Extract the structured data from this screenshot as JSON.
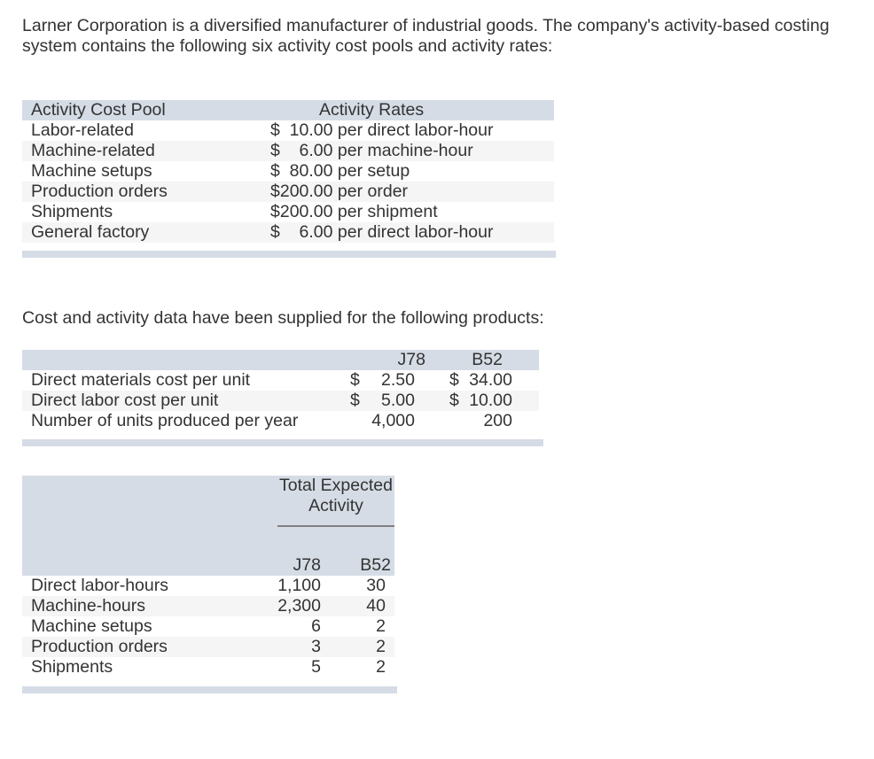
{
  "intro": "Larner Corporation is a diversified manufacturer of industrial goods. The company's activity-based costing system contains the following six activity cost pools and activity rates:",
  "table1": {
    "headers": [
      "Activity Cost Pool",
      "Activity Rates"
    ],
    "rows": [
      {
        "pool": "Labor-related",
        "rate": "$  10.00 per direct labor-hour"
      },
      {
        "pool": "Machine-related",
        "rate": "$    6.00 per machine-hour"
      },
      {
        "pool": "Machine setups",
        "rate": "$  80.00 per setup"
      },
      {
        "pool": "Production orders",
        "rate": "$200.00 per order"
      },
      {
        "pool": "Shipments",
        "rate": "$200.00 per shipment"
      },
      {
        "pool": "General factory",
        "rate": "$    6.00 per direct labor-hour"
      }
    ]
  },
  "section2_text": "Cost and activity data have been supplied for the following products:",
  "table2": {
    "headers": [
      "",
      "J78",
      "B52"
    ],
    "rows": [
      {
        "label": "Direct materials cost per unit",
        "j_cur": "$",
        "j78": "2.50",
        "b_cur": "$",
        "b52": "34.00"
      },
      {
        "label": "Direct labor cost per unit",
        "j_cur": "$",
        "j78": "5.00",
        "b_cur": "$",
        "b52": "10.00"
      },
      {
        "label": "Number of units produced per year",
        "j_cur": "",
        "j78": "4,000",
        "b_cur": "",
        "b52": "200"
      }
    ]
  },
  "table3": {
    "group_header_line1": "Total Expected",
    "group_header_line2": "Activity",
    "headers": [
      "",
      "J78",
      "B52"
    ],
    "rows": [
      {
        "label": "Direct labor-hours",
        "j78": "1,100",
        "b52": "30"
      },
      {
        "label": "Machine-hours",
        "j78": "2,300",
        "b52": "40"
      },
      {
        "label": "Machine setups",
        "j78": "6",
        "b52": "2"
      },
      {
        "label": "Production orders",
        "j78": "3",
        "b52": "2"
      },
      {
        "label": "Shipments",
        "j78": "5",
        "b52": "2"
      }
    ]
  }
}
